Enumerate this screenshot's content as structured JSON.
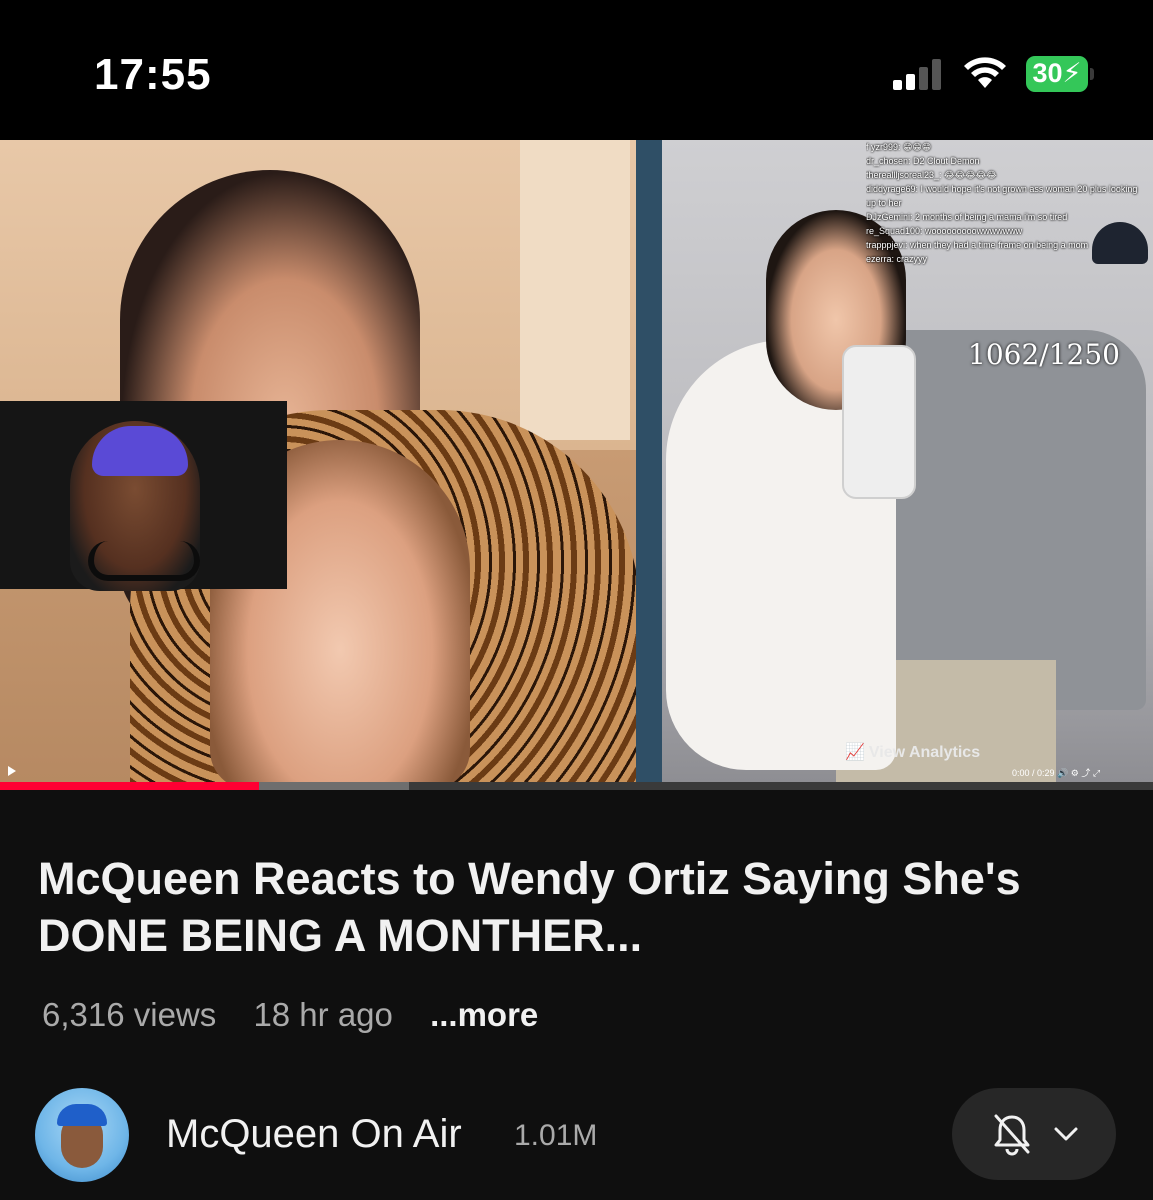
{
  "status_bar": {
    "time": "17:55",
    "battery_level": "30",
    "battery_color": "#34c759",
    "icons": [
      "signal-icon",
      "wifi-icon",
      "battery-charging-icon"
    ]
  },
  "video": {
    "overlay_chat": [
      "f yzr999: 😁😁😁",
      "dr_chosen: D2 Clout Demon",
      "thereallljsoreal23_: 😂😂😂😂😂",
      "diddyrage69: I would hope it's not grown ass woman 20 plus looking up to her",
      "DJzGemini: 2 months of being a mama i'm so tired",
      "re_Squad100: wooooooooowwwwwww",
      "trapppjevi: when they had a time frame on being a mom",
      "ezerra: crazyyy"
    ],
    "viewer_counter": "1062/1250",
    "analytics_label": "View Analytics",
    "analytics_icon": "chart-icon",
    "mini_time": "0:00 / 0:29",
    "progress_played": 0.225,
    "progress_buffered": 0.355,
    "progress_color": "#ff0033"
  },
  "info": {
    "title": "McQueen Reacts to Wendy Ortiz Saying She's DONE BEING A MONTHER...",
    "views": "6,316 views",
    "age": "18 hr ago",
    "more_label": "...more"
  },
  "channel": {
    "name": "McQueen On Air",
    "subscribers": "1.01M",
    "notification_icon": "bell-off-icon",
    "dropdown_icon": "chevron-down-icon"
  }
}
